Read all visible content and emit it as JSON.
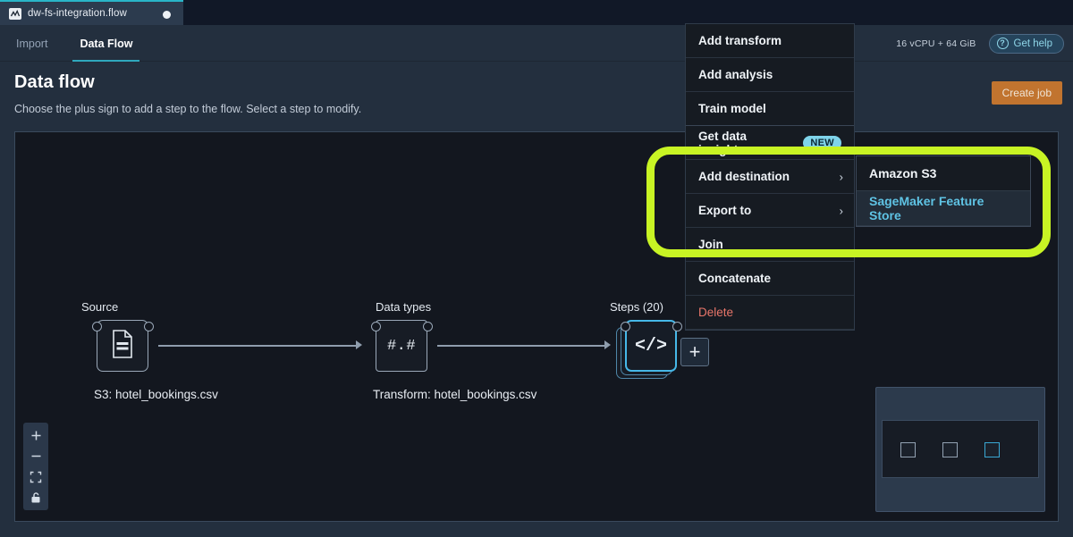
{
  "window": {
    "file_tab": {
      "name": "dw-fs-integration.flow",
      "icon": "flow-file-icon",
      "unsaved_indicator": "●"
    }
  },
  "header": {
    "tabs": [
      {
        "label": "Import",
        "active": false
      },
      {
        "label": "Data Flow",
        "active": true
      }
    ],
    "instance": "16 vCPU + 64 GiB",
    "help_label": "Get help",
    "help_icon": "question-circle-icon"
  },
  "page": {
    "title": "Data flow",
    "subtitle": "Choose the plus sign to add a step to the flow. Select a step to modify.",
    "create_job_label": "Create job"
  },
  "flow": {
    "nodes": [
      {
        "label": "Source",
        "caption": "S3: hotel_bookings.csv",
        "icon": "file-document-icon"
      },
      {
        "label": "Data types",
        "caption": "Transform: hotel_bookings.csv",
        "icon": "number-format-icon",
        "glyph": "#.#"
      },
      {
        "label": "Steps (20)",
        "caption": "",
        "icon": "code-brackets-icon",
        "glyph": "</>",
        "selected": true
      }
    ],
    "add_step_label": "+",
    "zoom_controls": [
      {
        "name": "zoom-in-button",
        "glyph": "+"
      },
      {
        "name": "zoom-out-button",
        "glyph": "–"
      },
      {
        "name": "fit-view-button",
        "glyph": "fit-icon"
      },
      {
        "name": "lock-canvas-button",
        "glyph": "lock-icon"
      }
    ],
    "minimap": {
      "nodes": [
        {
          "selected": false
        },
        {
          "selected": false
        },
        {
          "selected": true
        }
      ]
    }
  },
  "context_menu": {
    "items": [
      {
        "label": "Add transform",
        "submenu": false,
        "badge": null,
        "danger": false
      },
      {
        "label": "Add analysis",
        "submenu": false,
        "badge": null,
        "danger": false
      },
      {
        "label": "Train model",
        "submenu": false,
        "badge": null,
        "danger": false
      },
      {
        "label": "Get data insights",
        "submenu": false,
        "badge": "NEW",
        "danger": false
      },
      {
        "label": "Add destination",
        "submenu": true,
        "badge": null,
        "danger": false
      },
      {
        "label": "Export to",
        "submenu": true,
        "badge": null,
        "danger": false
      },
      {
        "label": "Join",
        "submenu": false,
        "badge": null,
        "danger": false
      },
      {
        "label": "Concatenate",
        "submenu": false,
        "badge": null,
        "danger": false
      },
      {
        "label": "Delete",
        "submenu": false,
        "badge": null,
        "danger": true
      }
    ],
    "chevron": "›"
  },
  "submenu": {
    "items": [
      {
        "label": "Amazon S3",
        "active": false
      },
      {
        "label": "SageMaker Feature Store",
        "active": true
      }
    ]
  },
  "annotation": {
    "highlight_color": "#c8f424",
    "describes": "Add destination / Export to submenu with SageMaker Feature Store"
  }
}
